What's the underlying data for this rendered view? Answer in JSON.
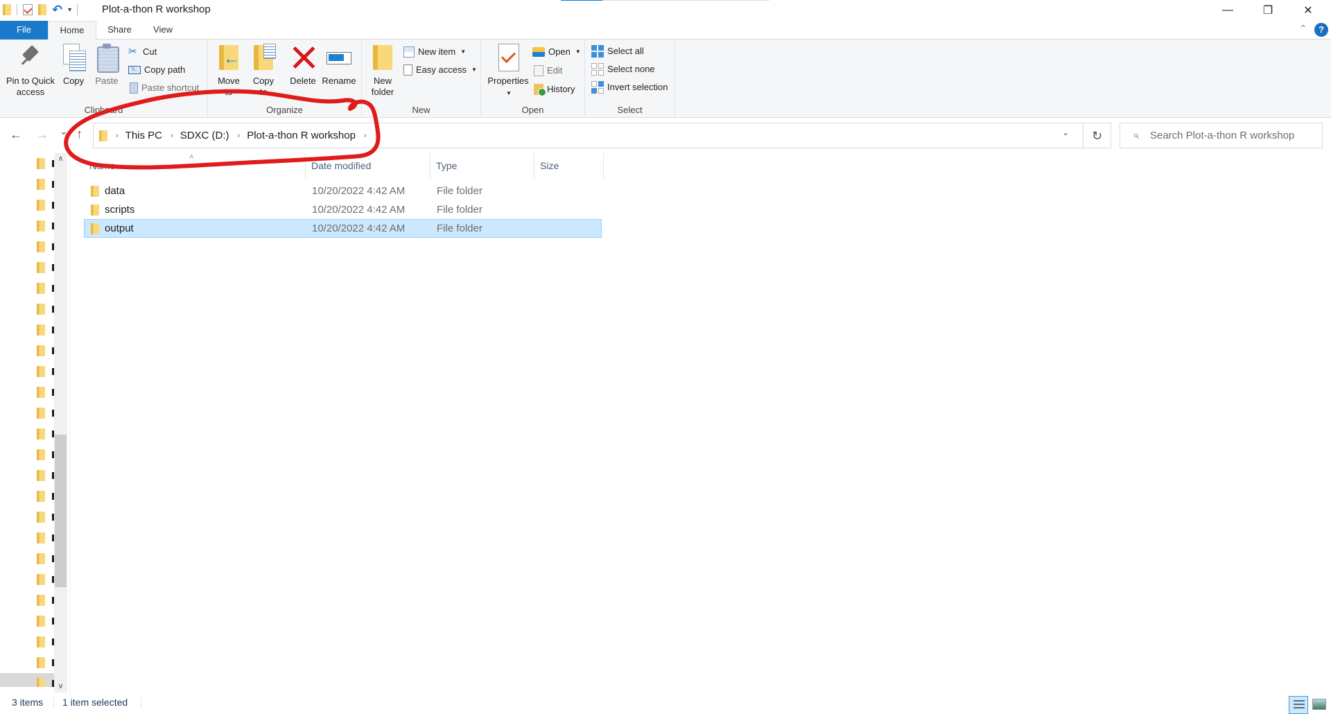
{
  "window": {
    "title": "Plot-a-thon R workshop",
    "controls": {
      "minimize": "—",
      "restore": "❐",
      "close": "✕"
    }
  },
  "quick_access_toolbar": {
    "icons": [
      "folder-icon",
      "properties-check-icon",
      "new-folder-icon",
      "undo-icon",
      "customize-dropdown-icon"
    ],
    "dropdown_glyph": "▾",
    "undo_glyph": "↶"
  },
  "ribbon_tabs": [
    {
      "label": "File"
    },
    {
      "label": "Home",
      "active": true
    },
    {
      "label": "Share"
    },
    {
      "label": "View"
    }
  ],
  "ribbon_help": {
    "collapse_glyph": "⌃",
    "help_glyph": "?"
  },
  "ribbon": {
    "clipboard": {
      "label": "Clipboard",
      "pin": "Pin to Quick access",
      "copy": "Copy",
      "paste": "Paste",
      "cut": "Cut",
      "copy_path": "Copy path",
      "paste_shortcut": "Paste shortcut"
    },
    "organize": {
      "label": "Organize",
      "move_to": "Move to",
      "copy_to": "Copy to",
      "delete": "Delete",
      "rename": "Rename"
    },
    "new": {
      "label": "New",
      "new_folder": "New folder",
      "new_item": "New item",
      "easy_access": "Easy access"
    },
    "open": {
      "label": "Open",
      "properties": "Properties",
      "open": "Open",
      "edit": "Edit",
      "history": "History"
    },
    "select": {
      "label": "Select",
      "select_all": "Select all",
      "select_none": "Select none",
      "invert_selection": "Invert selection"
    }
  },
  "navigation": {
    "back_glyph": "←",
    "forward_glyph": "→",
    "recent_glyph": "⌄",
    "up_glyph": "↑",
    "breadcrumb": [
      "This PC",
      "SDXC (D:)",
      "Plot-a-thon R workshop"
    ],
    "crumb_sep": "›",
    "dropdown_glyph": "⌄",
    "refresh_glyph": "↻"
  },
  "search": {
    "placeholder": "Search Plot-a-thon R workshop",
    "icon_glyph": "⌕"
  },
  "nav_pane": {
    "item_count_visible": 26,
    "selected_index": 25,
    "scroll": {
      "up_glyph": "∧",
      "down_glyph": "∨"
    }
  },
  "file_list": {
    "sort_glyph": "˄",
    "columns": [
      {
        "label": "Name"
      },
      {
        "label": "Date modified"
      },
      {
        "label": "Type"
      },
      {
        "label": "Size"
      }
    ],
    "rows": [
      {
        "name": "data",
        "date": "10/20/2022 4:42 AM",
        "type": "File folder",
        "size": "",
        "selected": false
      },
      {
        "name": "scripts",
        "date": "10/20/2022 4:42 AM",
        "type": "File folder",
        "size": "",
        "selected": false
      },
      {
        "name": "output",
        "date": "10/20/2022 4:42 AM",
        "type": "File folder",
        "size": "",
        "selected": true
      }
    ]
  },
  "status_bar": {
    "item_count": "3 items",
    "selection": "1 item selected"
  },
  "annotation": {
    "color": "#e01b1b",
    "shape": "freehand-ellipse-around-address-bar"
  }
}
